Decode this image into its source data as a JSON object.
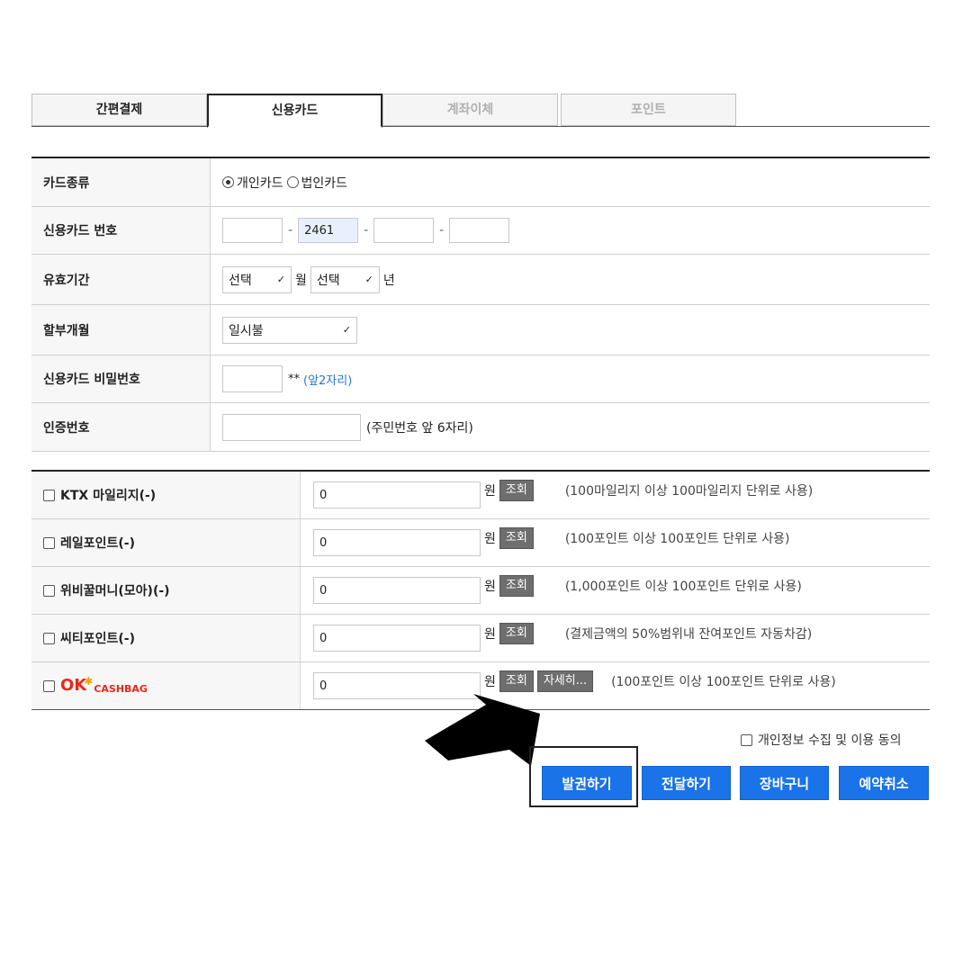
{
  "tabs": [
    "간편결제",
    "신용카드",
    "계좌이체",
    "포인트"
  ],
  "card_form": {
    "card_type_label": "카드종류",
    "personal_card": "개인카드",
    "corporate_card": "법인카드",
    "card_number_label": "신용카드 번호",
    "card_number_part2": "2461",
    "card_number_sep": "-",
    "expiry_label": "유효기간",
    "month_select": "선택",
    "month_unit": "월",
    "year_select": "선택",
    "year_unit": "년",
    "installment_label": "할부개월",
    "installment_value": "일시불",
    "password_label": "신용카드 비밀번호",
    "password_suffix": "**",
    "password_hint": "(앞2자리)",
    "auth_label": "인증번호",
    "auth_hint": "(주민번호 앞 6자리)"
  },
  "points": {
    "unit": "원",
    "lookup_label": "조회",
    "detail_label": "자세히...",
    "rows": [
      {
        "label": "KTX 마일리지(-)",
        "value": "0",
        "note": "(100마일리지 이상 100마일리지 단위로 사용)"
      },
      {
        "label": "레일포인트(-)",
        "value": "0",
        "note": "(100포인트 이상 100포인트 단위로 사용)"
      },
      {
        "label": "위비꿀머니(모아)(-)",
        "value": "0",
        "note": "(1,000포인트 이상 100포인트 단위로 사용)"
      },
      {
        "label": "씨티포인트(-)",
        "value": "0",
        "note": "(결제금액의 50%범위내 잔여포인트 자동차감)"
      },
      {
        "label": "OK CASHBAG",
        "value": "0",
        "note": "(100포인트 이상 100포인트 단위로 사용)"
      }
    ],
    "okcb_logo": {
      "ok": "OK",
      "cashbag": "CASHBAG"
    }
  },
  "consent_label": "개인정보 수집 및 이용 동의",
  "buttons": {
    "issue": "발권하기",
    "deliver": "전달하기",
    "cart": "장바구니",
    "cancel": "예약취소"
  },
  "colors": {
    "accent": "#1a73e8",
    "hint_blue": "#2a78c8",
    "lookup_gray": "#6e6e6e",
    "okcb_red": "#e8291c"
  }
}
